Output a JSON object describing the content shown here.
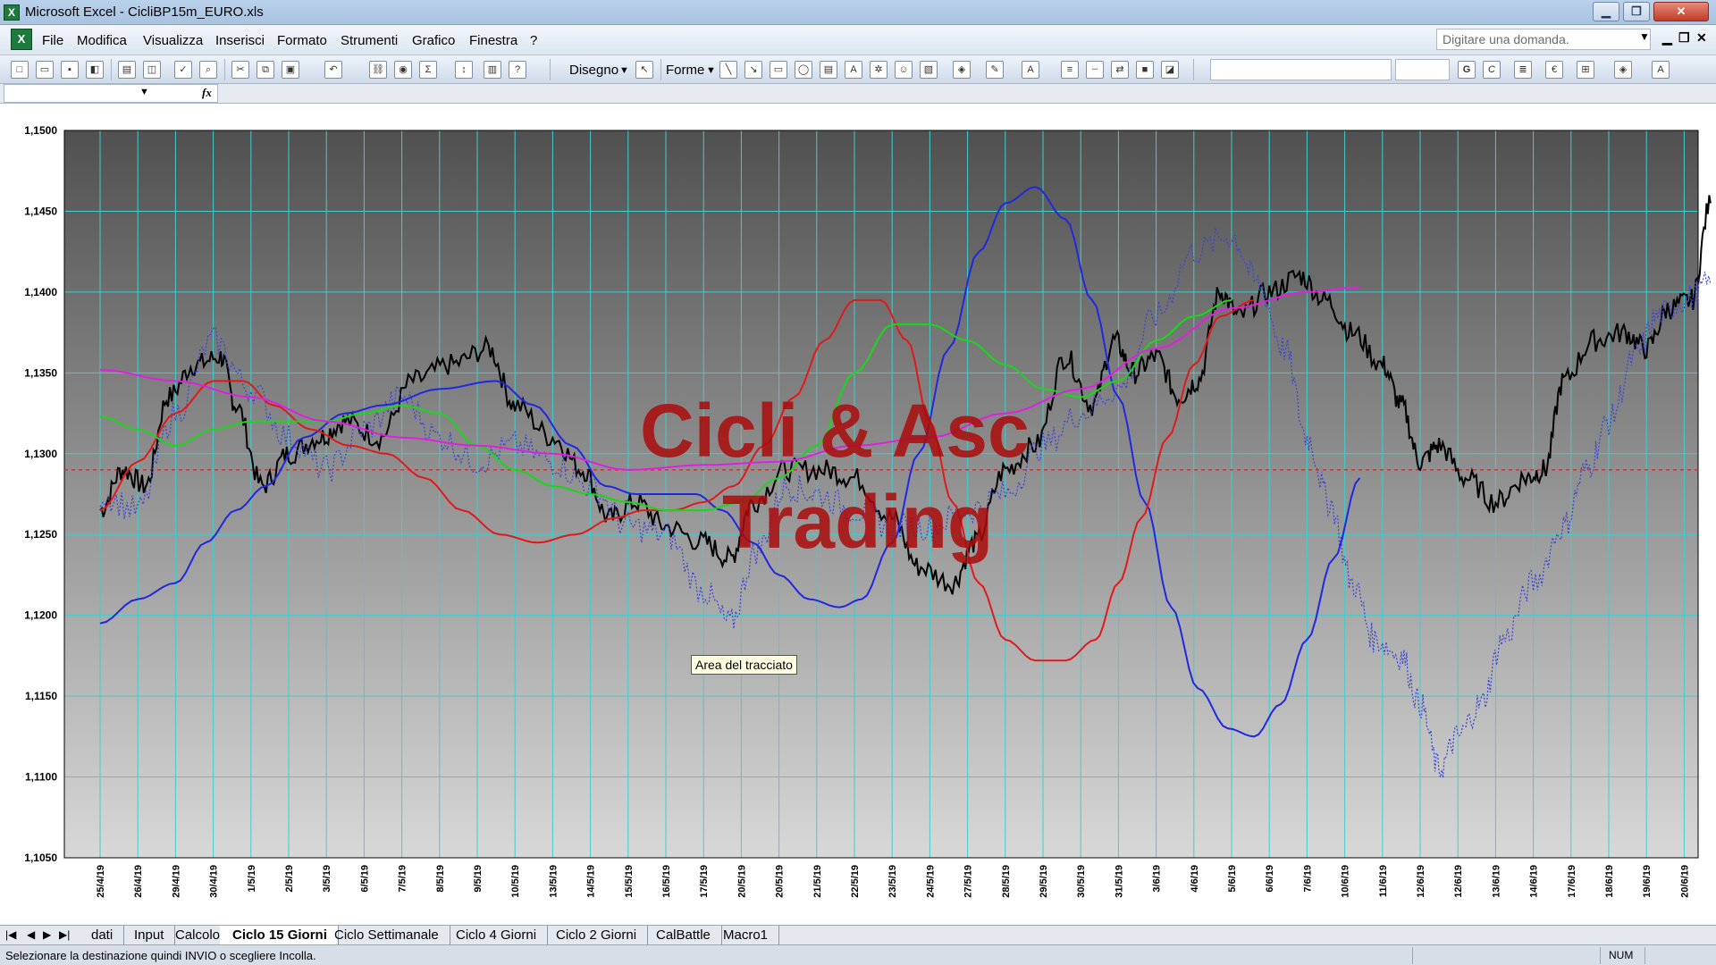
{
  "window": {
    "title": "Microsoft Excel - CicliBP15m_EURO.xls",
    "minimize": "▁",
    "maximize": "❐",
    "close": "✕"
  },
  "menu": {
    "items": [
      "File",
      "Modifica",
      "Visualizza",
      "Inserisci",
      "Formato",
      "Strumenti",
      "Grafico",
      "Finestra",
      "?"
    ],
    "help_placeholder": "Digitare una domanda.",
    "mdi_minimize": "▁",
    "mdi_restore": "❐",
    "mdi_close": "✕"
  },
  "toolbar": {
    "disegno_label": "Disegno",
    "forme_label": "Forme",
    "bold": "G",
    "italic": "C",
    "euro": "€",
    "sigma": "Σ"
  },
  "formula_bar": {
    "name_box": "",
    "fx": "fx"
  },
  "chart": {
    "watermark_line1": "Cicli & Asc",
    "watermark_line2": "Trading",
    "tooltip": "Area del tracciato"
  },
  "chart_data": {
    "type": "line",
    "y_ticks": [
      "1,1500",
      "1,1450",
      "1,1400",
      "1,1350",
      "1,1300",
      "1,1250",
      "1,1200",
      "1,1150",
      "1,1100",
      "1,1050"
    ],
    "ylim": [
      1.105,
      1.15
    ],
    "x_ticks": [
      "25/4/19",
      "26/4/19",
      "29/4/19",
      "30/4/19",
      "1/5/19",
      "2/5/19",
      "3/5/19",
      "6/5/19",
      "7/5/19",
      "8/5/19",
      "9/5/19",
      "10/5/19",
      "13/5/19",
      "14/5/19",
      "15/5/19",
      "16/5/19",
      "17/5/19",
      "20/5/19",
      "20/5/19",
      "21/5/19",
      "22/5/19",
      "23/5/19",
      "24/5/19",
      "27/5/19",
      "28/5/19",
      "29/5/19",
      "30/5/19",
      "31/5/19",
      "3/6/19",
      "4/6/19",
      "5/6/19",
      "6/6/19",
      "7/6/19",
      "10/6/19",
      "11/6/19",
      "12/6/19",
      "12/6/19",
      "13/6/19",
      "14/6/19",
      "17/6/19",
      "18/6/19",
      "19/6/19",
      "20/6/19",
      "21/6/19"
    ],
    "grid": true,
    "reference_line": {
      "value": 1.129,
      "color": "#ff2020"
    },
    "series": [
      {
        "color": "#000000",
        "style": "solid",
        "anchors": [
          [
            0,
            1.1265
          ],
          [
            0.6,
            1.129
          ],
          [
            1.2,
            1.128
          ],
          [
            1.8,
            1.1335
          ],
          [
            2.5,
            1.1355
          ],
          [
            3.2,
            1.136
          ],
          [
            3.6,
            1.133
          ],
          [
            4.3,
            1.128
          ],
          [
            5.0,
            1.13
          ],
          [
            5.8,
            1.131
          ],
          [
            6.5,
            1.132
          ],
          [
            7.4,
            1.131
          ],
          [
            8.3,
            1.1345
          ],
          [
            9.3,
            1.1355
          ],
          [
            10.3,
            1.1365
          ],
          [
            11.0,
            1.133
          ],
          [
            12.0,
            1.131
          ],
          [
            12.8,
            1.129
          ],
          [
            13.5,
            1.126
          ],
          [
            14.2,
            1.127
          ],
          [
            15.0,
            1.1255
          ],
          [
            16.0,
            1.1245
          ],
          [
            16.7,
            1.1235
          ],
          [
            17.3,
            1.127
          ],
          [
            18.2,
            1.129
          ],
          [
            19.2,
            1.129
          ],
          [
            20.0,
            1.1285
          ],
          [
            21.0,
            1.126
          ],
          [
            21.7,
            1.123
          ],
          [
            22.6,
            1.122
          ],
          [
            23.2,
            1.1245
          ],
          [
            24.0,
            1.129
          ],
          [
            24.8,
            1.1305
          ],
          [
            25.6,
            1.136
          ],
          [
            26.3,
            1.133
          ],
          [
            26.9,
            1.137
          ],
          [
            27.4,
            1.135
          ],
          [
            28.0,
            1.136
          ],
          [
            28.6,
            1.1335
          ],
          [
            29.1,
            1.1345
          ],
          [
            29.7,
            1.14
          ],
          [
            30.2,
            1.1385
          ],
          [
            31.0,
            1.14
          ],
          [
            31.8,
            1.141
          ],
          [
            32.5,
            1.1395
          ],
          [
            33.2,
            1.1375
          ],
          [
            34.0,
            1.1355
          ],
          [
            34.5,
            1.133
          ],
          [
            35.0,
            1.1295
          ],
          [
            35.5,
            1.1305
          ],
          [
            36.2,
            1.1285
          ],
          [
            37.0,
            1.127
          ],
          [
            37.8,
            1.1285
          ],
          [
            38.3,
            1.129
          ],
          [
            38.8,
            1.1345
          ],
          [
            39.6,
            1.137
          ],
          [
            40.4,
            1.1375
          ],
          [
            41.0,
            1.1365
          ],
          [
            41.6,
            1.139
          ],
          [
            42.2,
            1.1395
          ],
          [
            42.7,
            1.1455
          ]
        ]
      },
      {
        "color": "#3a44d8",
        "style": "dotted",
        "anchors": [
          [
            0,
            1.1275
          ],
          [
            1.0,
            1.1265
          ],
          [
            2.0,
            1.1325
          ],
          [
            3.0,
            1.137
          ],
          [
            4.0,
            1.134
          ],
          [
            5.0,
            1.131
          ],
          [
            6.0,
            1.129
          ],
          [
            7.0,
            1.1315
          ],
          [
            8.0,
            1.1335
          ],
          [
            9.0,
            1.131
          ],
          [
            10.0,
            1.1295
          ],
          [
            11.0,
            1.1305
          ],
          [
            12.0,
            1.1295
          ],
          [
            13.0,
            1.128
          ],
          [
            14.0,
            1.1255
          ],
          [
            15.0,
            1.125
          ],
          [
            16.0,
            1.1215
          ],
          [
            16.7,
            1.1195
          ],
          [
            17.4,
            1.124
          ],
          [
            18.2,
            1.128
          ],
          [
            19.0,
            1.1275
          ],
          [
            20.0,
            1.1265
          ],
          [
            21.0,
            1.1255
          ],
          [
            22.0,
            1.1255
          ],
          [
            23.0,
            1.1265
          ],
          [
            24.0,
            1.1275
          ],
          [
            25.0,
            1.1305
          ],
          [
            26.0,
            1.1325
          ],
          [
            27.0,
            1.134
          ],
          [
            28.0,
            1.1385
          ],
          [
            29.0,
            1.1425
          ],
          [
            30.0,
            1.1435
          ],
          [
            30.7,
            1.1405
          ],
          [
            31.4,
            1.1365
          ],
          [
            32.0,
            1.131
          ],
          [
            32.6,
            1.127
          ],
          [
            33.2,
            1.122
          ],
          [
            33.8,
            1.1185
          ],
          [
            34.5,
            1.1175
          ],
          [
            35.0,
            1.1145
          ],
          [
            35.5,
            1.1105
          ],
          [
            36.0,
            1.1125
          ],
          [
            36.6,
            1.1145
          ],
          [
            37.2,
            1.1185
          ],
          [
            38.0,
            1.122
          ],
          [
            38.8,
            1.1255
          ],
          [
            39.4,
            1.129
          ],
          [
            40.0,
            1.132
          ],
          [
            40.7,
            1.136
          ],
          [
            41.3,
            1.1385
          ],
          [
            42.0,
            1.1395
          ],
          [
            42.7,
            1.1405
          ]
        ]
      },
      {
        "color": "#2028e0",
        "style": "solid",
        "anchors": [
          [
            0,
            1.1195
          ],
          [
            1.0,
            1.121
          ],
          [
            2.0,
            1.122
          ],
          [
            2.8,
            1.1245
          ],
          [
            3.6,
            1.1265
          ],
          [
            4.4,
            1.128
          ],
          [
            5.4,
            1.131
          ],
          [
            6.5,
            1.1325
          ],
          [
            7.5,
            1.133
          ],
          [
            9.0,
            1.134
          ],
          [
            10.5,
            1.1345
          ],
          [
            11.5,
            1.133
          ],
          [
            12.5,
            1.1305
          ],
          [
            13.4,
            1.128
          ],
          [
            14.2,
            1.1275
          ],
          [
            15.0,
            1.1275
          ],
          [
            15.8,
            1.1275
          ],
          [
            16.5,
            1.1265
          ],
          [
            17.3,
            1.1245
          ],
          [
            18.0,
            1.1225
          ],
          [
            18.8,
            1.121
          ],
          [
            19.6,
            1.1205
          ],
          [
            20.2,
            1.121
          ],
          [
            21.0,
            1.1245
          ],
          [
            21.7,
            1.13
          ],
          [
            22.5,
            1.1365
          ],
          [
            23.3,
            1.1425
          ],
          [
            24.0,
            1.1455
          ],
          [
            24.8,
            1.1465
          ],
          [
            25.6,
            1.1445
          ],
          [
            26.3,
            1.1395
          ],
          [
            27.0,
            1.1335
          ],
          [
            27.7,
            1.127
          ],
          [
            28.4,
            1.1205
          ],
          [
            29.1,
            1.1155
          ],
          [
            29.9,
            1.113
          ],
          [
            30.6,
            1.1125
          ],
          [
            31.3,
            1.1145
          ],
          [
            32.0,
            1.1185
          ],
          [
            32.7,
            1.1235
          ],
          [
            33.4,
            1.1285
          ]
        ]
      },
      {
        "color": "#e01a1a",
        "style": "solid",
        "anchors": [
          [
            0,
            1.1265
          ],
          [
            1.0,
            1.1295
          ],
          [
            2.0,
            1.1325
          ],
          [
            3.0,
            1.1345
          ],
          [
            3.8,
            1.1345
          ],
          [
            4.6,
            1.133
          ],
          [
            5.6,
            1.1315
          ],
          [
            6.6,
            1.1305
          ],
          [
            7.6,
            1.13
          ],
          [
            8.6,
            1.1285
          ],
          [
            9.6,
            1.1265
          ],
          [
            10.6,
            1.125
          ],
          [
            11.6,
            1.1245
          ],
          [
            12.6,
            1.125
          ],
          [
            13.6,
            1.126
          ],
          [
            14.4,
            1.1265
          ],
          [
            15.2,
            1.1265
          ],
          [
            16.0,
            1.127
          ],
          [
            16.8,
            1.128
          ],
          [
            17.6,
            1.1305
          ],
          [
            18.4,
            1.1335
          ],
          [
            19.2,
            1.137
          ],
          [
            20.0,
            1.1395
          ],
          [
            20.7,
            1.1395
          ],
          [
            21.4,
            1.137
          ],
          [
            22.0,
            1.132
          ],
          [
            22.6,
            1.127
          ],
          [
            23.3,
            1.122
          ],
          [
            24.0,
            1.1185
          ],
          [
            24.8,
            1.1172
          ],
          [
            25.6,
            1.1172
          ],
          [
            26.4,
            1.1185
          ],
          [
            27.0,
            1.122
          ],
          [
            27.6,
            1.126
          ],
          [
            28.3,
            1.131
          ],
          [
            29.0,
            1.1355
          ],
          [
            29.7,
            1.1385
          ],
          [
            30.6,
            1.1395
          ]
        ]
      },
      {
        "color": "#18d818",
        "style": "solid",
        "anchors": [
          [
            0,
            1.1323
          ],
          [
            1.0,
            1.1315
          ],
          [
            2.0,
            1.1305
          ],
          [
            3.0,
            1.1315
          ],
          [
            4.0,
            1.132
          ],
          [
            5.0,
            1.132
          ],
          [
            6.0,
            1.132
          ],
          [
            7.0,
            1.1325
          ],
          [
            8.0,
            1.133
          ],
          [
            9.0,
            1.1325
          ],
          [
            10.0,
            1.1305
          ],
          [
            11.0,
            1.129
          ],
          [
            12.0,
            1.128
          ],
          [
            13.0,
            1.1275
          ],
          [
            14.0,
            1.127
          ],
          [
            15.0,
            1.1265
          ],
          [
            16.0,
            1.1265
          ],
          [
            17.0,
            1.127
          ],
          [
            18.0,
            1.1285
          ],
          [
            19.0,
            1.1305
          ],
          [
            20.0,
            1.135
          ],
          [
            21.0,
            1.138
          ],
          [
            22.0,
            1.138
          ],
          [
            23.0,
            1.137
          ],
          [
            24.0,
            1.1355
          ],
          [
            25.0,
            1.134
          ],
          [
            26.0,
            1.1335
          ],
          [
            27.0,
            1.1345
          ],
          [
            28.0,
            1.137
          ],
          [
            29.0,
            1.1385
          ],
          [
            30.0,
            1.1395
          ]
        ]
      },
      {
        "color": "#e020e0",
        "style": "solid",
        "anchors": [
          [
            0,
            1.1352
          ],
          [
            2.0,
            1.1345
          ],
          [
            4.0,
            1.1335
          ],
          [
            6.0,
            1.132
          ],
          [
            8.0,
            1.131
          ],
          [
            10.0,
            1.1305
          ],
          [
            12.0,
            1.13
          ],
          [
            14.0,
            1.129
          ],
          [
            16.0,
            1.1293
          ],
          [
            18.0,
            1.1295
          ],
          [
            20.0,
            1.1305
          ],
          [
            22.0,
            1.131
          ],
          [
            24.0,
            1.1325
          ],
          [
            26.0,
            1.134
          ],
          [
            28.0,
            1.1365
          ],
          [
            30.0,
            1.139
          ],
          [
            32.0,
            1.14
          ],
          [
            33.4,
            1.1403
          ]
        ]
      }
    ]
  },
  "sheet_tabs": [
    "dati",
    "Input",
    "Calcolo",
    "Ciclo 15 Giorni",
    "Ciclo Settimanale",
    "Ciclo 4 Giorni",
    "Ciclo 2 Giorni",
    "CalBattle",
    "Macro1"
  ],
  "active_tab": "Ciclo 15 Giorni",
  "status": {
    "text": "Selezionare la destinazione quindi INVIO o scegliere Incolla.",
    "num": "NUM"
  }
}
